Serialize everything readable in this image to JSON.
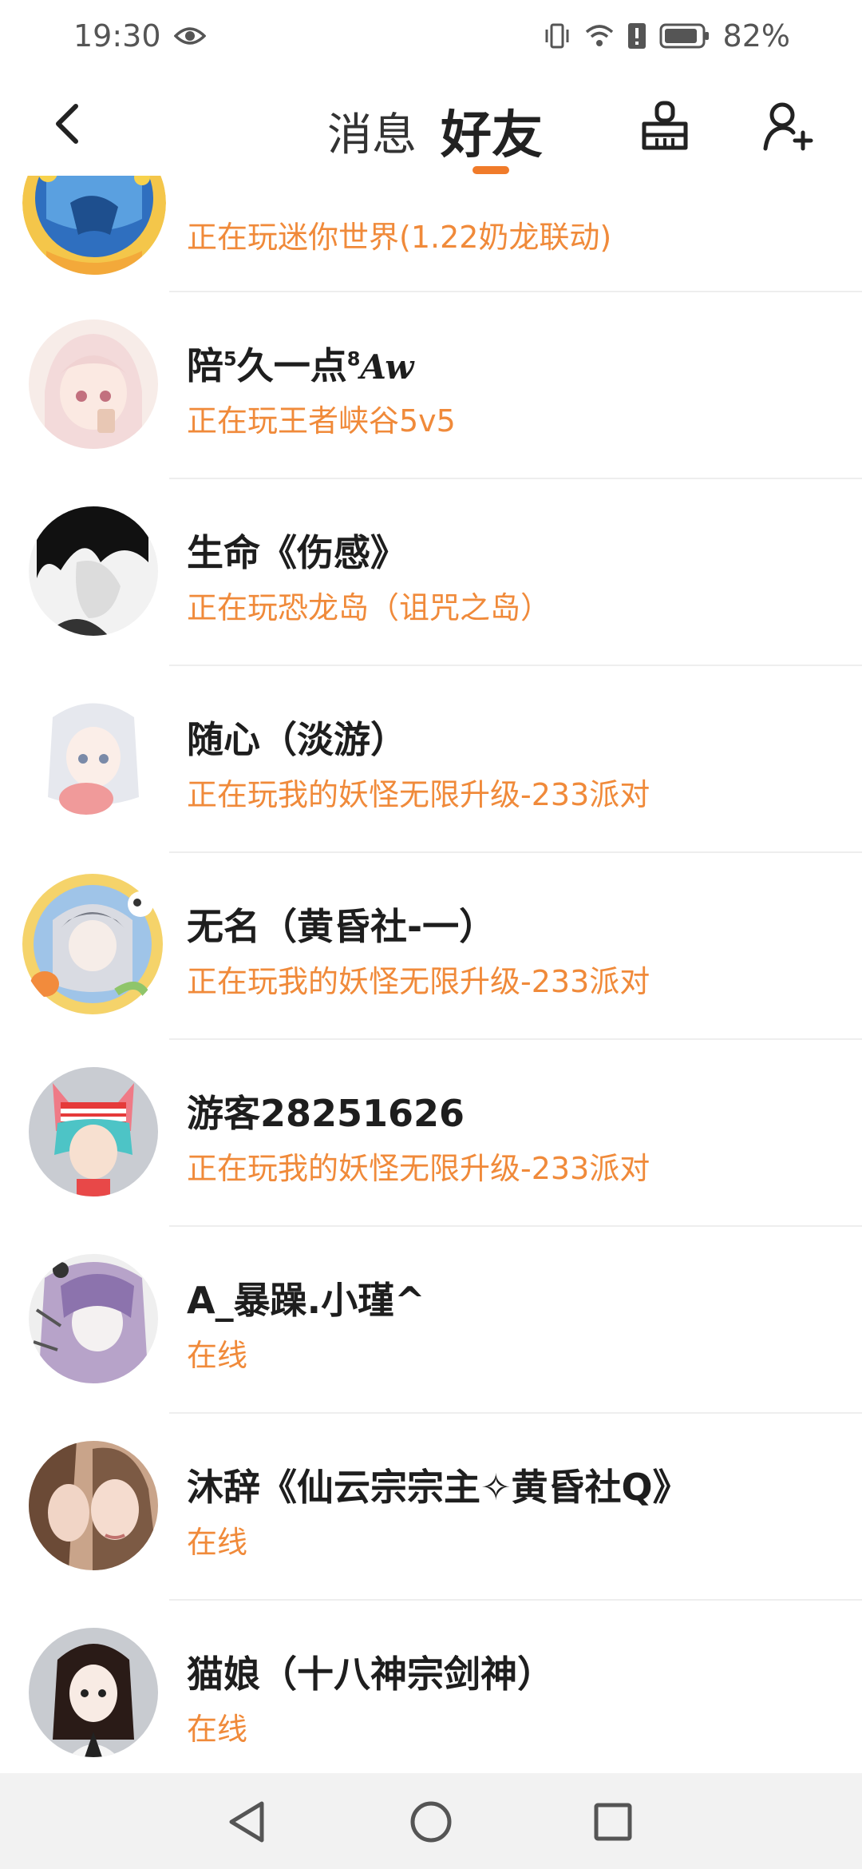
{
  "status_bar": {
    "time": "19:30",
    "battery": "82%"
  },
  "header": {
    "tab_messages": "消息",
    "tab_friends": "好友",
    "accent_color": "#f07b2a"
  },
  "friends": [
    {
      "name": "",
      "status": "正在玩迷你世界(1.22奶龙联动)"
    },
    {
      "name_main": "陪",
      "sup1": "5",
      "name_mid": "久一点",
      "sup2": "8",
      "name_tail": "Aw",
      "status": "正在玩王者峡谷5v5"
    },
    {
      "name": "生命《伤感》",
      "status": "正在玩恐龙岛（诅咒之岛）"
    },
    {
      "name": "随心（淡游）",
      "status": "正在玩我的妖怪无限升级-233派对"
    },
    {
      "name": "无名（黄昏社-一）",
      "status": "正在玩我的妖怪无限升级-233派对"
    },
    {
      "name": "游客28251626",
      "status": "正在玩我的妖怪无限升级-233派对"
    },
    {
      "name": "A_暴躁.小瑾^",
      "status": "在线"
    },
    {
      "name": "沐辞《仙云宗宗主✧黄昏社Q》",
      "status": "在线"
    },
    {
      "name": "猫娘（十八神宗剑神）",
      "status": "在线"
    }
  ],
  "colors": {
    "status_text": "#f08a3a",
    "name_text": "#1e1e1e",
    "nav_bar_bg": "#f2f2f2"
  }
}
